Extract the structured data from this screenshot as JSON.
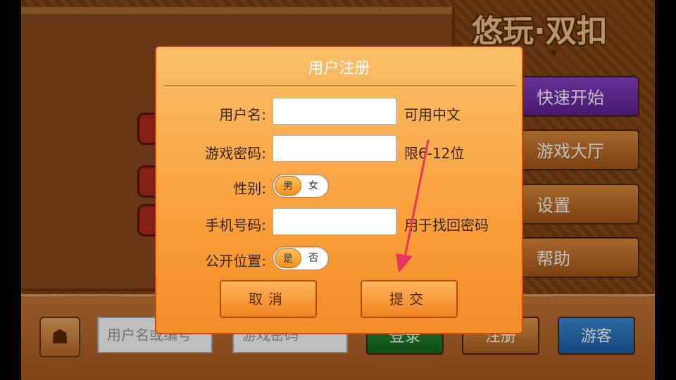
{
  "background": {
    "logo": "悠玩·双扣",
    "menu": [
      "快速开始",
      "游戏大厅",
      "设置",
      "帮助"
    ],
    "bottom": {
      "username_placeholder": "用户名或编号",
      "password_placeholder": "游戏密码",
      "login_label": "登录",
      "register_label": "注册",
      "guest_label": "游客"
    }
  },
  "dialog": {
    "title": "用户注册",
    "username": {
      "label": "用户名:",
      "value": "",
      "hint": "可用中文"
    },
    "password": {
      "label": "游戏密码:",
      "value": "",
      "hint": "限6-12位"
    },
    "gender": {
      "label": "性别:",
      "options": [
        "男",
        "女"
      ],
      "selected": "男"
    },
    "phone": {
      "label": "手机号码:",
      "value": "",
      "hint": "用于找回密码"
    },
    "location": {
      "label": "公开位置:",
      "options": [
        "是",
        "否"
      ],
      "selected": "是"
    },
    "cancel_label": "取消",
    "submit_label": "提交"
  },
  "colors": {
    "dialog_accent": "#f99a35",
    "annotation_arrow": "#e8355a",
    "menu_primary": "#6a2aa8",
    "guest_button": "#2a76c2"
  }
}
